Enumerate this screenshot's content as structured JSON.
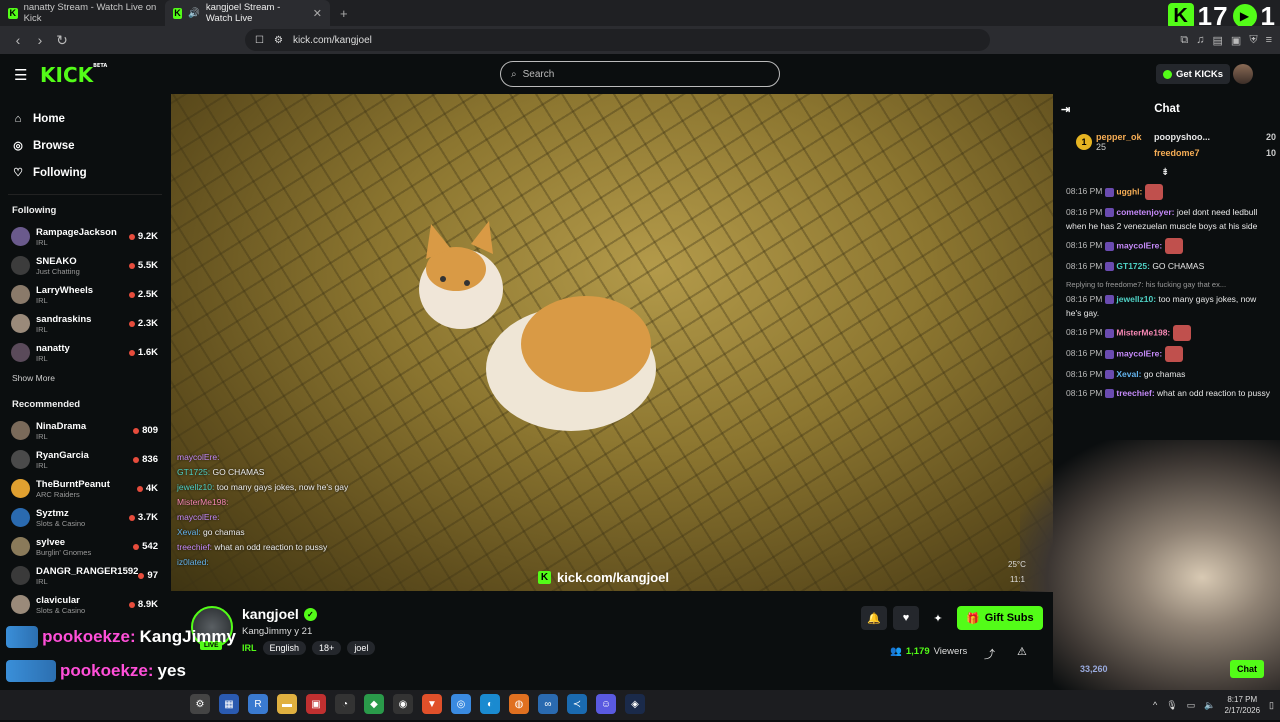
{
  "browser": {
    "tabs": [
      {
        "title": "nanatty Stream - Watch Live on Kick",
        "active": false
      },
      {
        "title": "kangjoel Stream - Watch Live",
        "active": true
      }
    ],
    "url": "kick.com/kangjoel",
    "overlay_counter": "17",
    "overlay_counter_right": "1"
  },
  "header": {
    "logo": "KICK",
    "logo_sup": "BETA",
    "search_placeholder": "Search",
    "get_kicks": "Get KICKs"
  },
  "sidebar": {
    "nav": [
      {
        "label": "Home",
        "icon": "home-icon"
      },
      {
        "label": "Browse",
        "icon": "compass-icon"
      },
      {
        "label": "Following",
        "icon": "heart-icon"
      }
    ],
    "following_title": "Following",
    "following": [
      {
        "name": "RampageJackson",
        "category": "IRL",
        "viewers": "9.2K",
        "color": "#6a5a8c"
      },
      {
        "name": "SNEAKO",
        "category": "Just Chatting",
        "viewers": "5.5K",
        "color": "#3c3c3c"
      },
      {
        "name": "LarryWheels",
        "category": "IRL",
        "viewers": "2.5K",
        "color": "#8a7a6a"
      },
      {
        "name": "sandraskins",
        "category": "IRL",
        "viewers": "2.3K",
        "color": "#9a8a7a"
      },
      {
        "name": "nanatty",
        "category": "IRL",
        "viewers": "1.6K",
        "color": "#5a4a5a"
      }
    ],
    "show_more": "Show More",
    "recommended_title": "Recommended",
    "recommended": [
      {
        "name": "NinaDrama",
        "category": "IRL",
        "viewers": "809",
        "color": "#7a6a5a"
      },
      {
        "name": "RyanGarcia",
        "category": "IRL",
        "viewers": "836",
        "color": "#4a4a4a"
      },
      {
        "name": "TheBurntPeanut",
        "category": "ARC Raiders",
        "viewers": "4K",
        "color": "#e0a030"
      },
      {
        "name": "Syztmz",
        "category": "Slots & Casino",
        "viewers": "3.7K",
        "color": "#2a6ab0"
      },
      {
        "name": "sylvee",
        "category": "Burglin' Gnomes",
        "viewers": "542",
        "color": "#8a7a5a"
      },
      {
        "name": "DANGR_RANGER1592",
        "category": "IRL",
        "viewers": "97",
        "color": "#3a3a3a"
      },
      {
        "name": "clavicular",
        "category": "Slots & Casino",
        "viewers": "8.9K",
        "color": "#9a8a7a"
      }
    ]
  },
  "video": {
    "watermark": "kick.com/kangjoel",
    "overlay_chat": [
      {
        "user": "maycolEre:",
        "text": "",
        "color": "#c58af9"
      },
      {
        "user": "GT1725:",
        "text": "GO CHAMAS",
        "color": "#4fd1c5"
      },
      {
        "user": "jewellz10:",
        "text": "too many gays jokes, now he's gay",
        "color": "#4fd1c5"
      },
      {
        "user": "MisterMe198:",
        "text": "",
        "color": "#f687b3"
      },
      {
        "user": "maycolEre:",
        "text": "",
        "color": "#c58af9"
      },
      {
        "user": "Xeval:",
        "text": "go chamas",
        "color": "#63b3ed"
      },
      {
        "user": "treechief:",
        "text": "what an odd reaction to pussy",
        "color": "#c58af9"
      },
      {
        "user": "iz0lated:",
        "text": "",
        "color": "#63b3ed"
      }
    ]
  },
  "streamer": {
    "name": "kangjoel",
    "title": "KangJimmy",
    "title_suffix": "y 21",
    "live": "LIVE",
    "category": "IRL",
    "tags": [
      "English",
      "18+",
      "joel"
    ],
    "viewers": "1,179",
    "viewers_label": "Viewers",
    "gift_subs": "Gift Subs"
  },
  "chat": {
    "title": "Chat",
    "leaderboard": {
      "first": {
        "rank": "1",
        "name": "pepper_ok",
        "count": "25"
      },
      "others": [
        {
          "name": "poopyshoo...",
          "count": "20",
          "color": "#ffffff"
        },
        {
          "name": "freedome7",
          "count": "10",
          "color": "#f6ad55"
        }
      ]
    },
    "messages": [
      {
        "time": "08:16 PM",
        "user": "ugghl:",
        "text": "",
        "color": "#f6ad55",
        "emote": true
      },
      {
        "time": "08:16 PM",
        "user": "cometenjoyer:",
        "text": "joel dont need ledbull when he has 2 venezuelan muscle boys at his side",
        "color": "#c58af9",
        "emote": false
      },
      {
        "time": "08:16 PM",
        "user": "maycolEre:",
        "text": "",
        "color": "#c58af9",
        "emote": true
      },
      {
        "time": "08:16 PM",
        "user": "GT1725:",
        "text": "GO CHAMAS",
        "color": "#4fd1c5",
        "emote": false
      },
      {
        "time": "08:16 PM",
        "user": "jewellz10:",
        "text": "too many gays jokes, now he's gay.",
        "color": "#4fd1c5",
        "emote": false,
        "reply": "Replying to freedome7: his fucking gay that ex..."
      },
      {
        "time": "08:16 PM",
        "user": "MisterMe198:",
        "text": "",
        "color": "#f687b3",
        "emote": true
      },
      {
        "time": "08:16 PM",
        "user": "maycolEre:",
        "text": "",
        "color": "#c58af9",
        "emote": true
      },
      {
        "time": "08:16 PM",
        "user": "Xeval:",
        "text": "go chamas",
        "color": "#63b3ed",
        "emote": false
      },
      {
        "time": "08:16 PM",
        "user": "treechief:",
        "text": "what an odd reaction to pussy",
        "color": "#c58af9",
        "emote": false
      }
    ],
    "chat_button": "Chat",
    "webcam_temp": "25°C",
    "webcam_time": "11:1",
    "webcam_kicks": "33,260"
  },
  "stream_overlay": [
    {
      "user": "pookoekze:",
      "text": "KangJimmy"
    },
    {
      "user": "pookoekze:",
      "text": "yes"
    },
    {
      "user": "pookoekze",
      "text": ""
    }
  ],
  "taskbar": {
    "time": "8:17 PM",
    "date": "2/17/2026"
  },
  "colors": {
    "accent": "#53fc18",
    "background": "#0b0e0f"
  }
}
